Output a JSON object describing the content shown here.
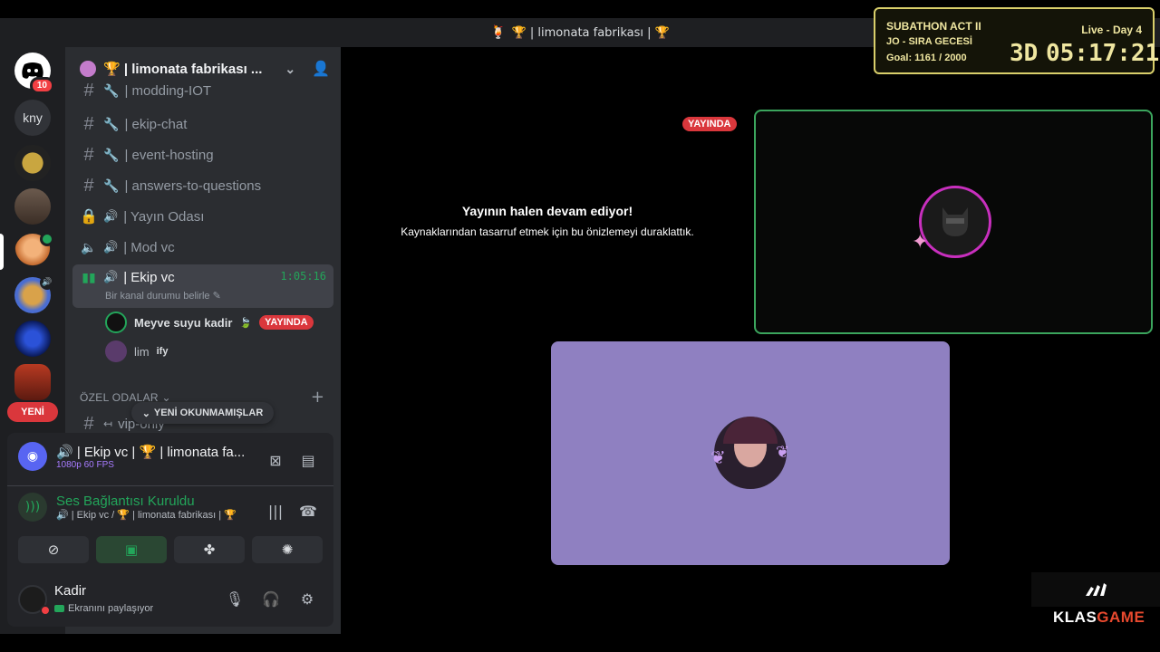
{
  "window": {
    "title": "🏆 | limonata fabrikası | 🏆"
  },
  "rail": {
    "dm_badge": "10",
    "server_text": "kny",
    "new_label": "YENİ"
  },
  "server": {
    "name": "🏆 | limonata fabrikası ..."
  },
  "channels": [
    {
      "label": "| modding-IOT"
    },
    {
      "label": "| ekip-chat"
    },
    {
      "label": "| event-hosting"
    },
    {
      "label": "| answers-to-questions"
    },
    {
      "label": "| Yayın Odası"
    },
    {
      "label": "| Mod vc"
    }
  ],
  "active_channel": {
    "label": "| Ekip vc",
    "timer": "1:05:16",
    "status_placeholder": "Bir kanal durumu belirle"
  },
  "voice_users": [
    {
      "name": "Meyve suyu kadir",
      "tag": "YAYINDA"
    },
    {
      "name": "lim",
      "activity": "ify"
    }
  ],
  "category": {
    "label": "ÖZEL ODALAR",
    "next_channel": "vip-only"
  },
  "unread_pill": "YENİ OKUNMAMIŞLAR",
  "voice_panel": {
    "stream_title": "🔊 | Ekip vc | 🏆 | limonata fa...",
    "stream_quality": "1080p 60 FPS",
    "conn_title": "Ses Bağlantısı Kuruldu",
    "conn_sub": "🔊 | Ekip vc / 🏆 | limonata fabrikası | 🏆"
  },
  "user": {
    "name": "Kadir",
    "status": "Ekranını paylaşıyor"
  },
  "stream": {
    "live_tag": "YAYINDA",
    "paused_title": "Yayının halen devam ediyor!",
    "paused_sub": "Kaynaklarından tasarruf etmek için bu önizlemeyi duraklattık."
  },
  "overlay": {
    "title": "SUBATHON ACT II",
    "subtitle": "JO - SIRA GECESİ",
    "goal": "Goal: 1161 / 2000",
    "live": "Live - Day 4",
    "days": "3D",
    "time": "05:17:21"
  },
  "watermark": {
    "part1": "KLAS",
    "part2": "GAME"
  },
  "colors": {
    "accent": "#5865f2",
    "live_red": "#da373c",
    "voice_green": "#23a55a",
    "tile_purple": "#8f80c1"
  }
}
